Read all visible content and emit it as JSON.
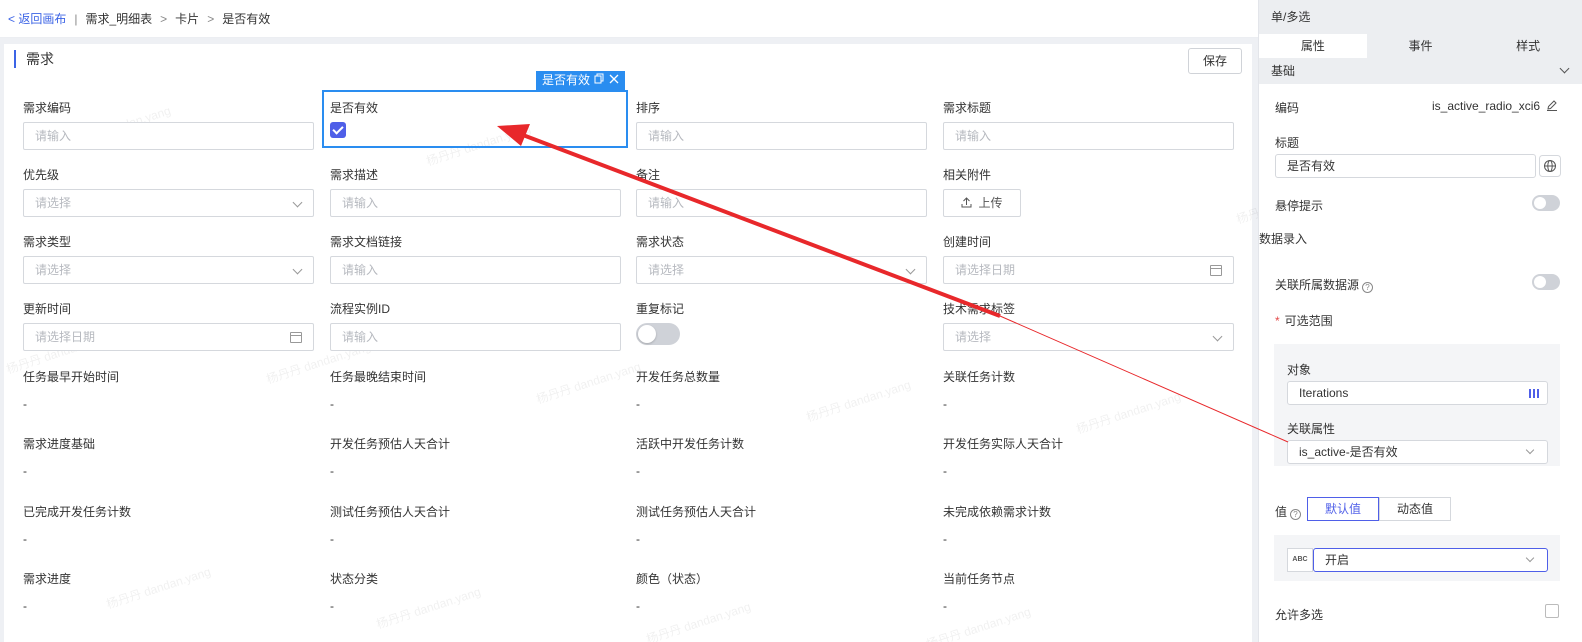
{
  "breadcrumb": {
    "back": "< 返回画布",
    "items": [
      "需求_明细表",
      "卡片",
      "是否有效"
    ],
    "sep1": "|",
    "sep": ">"
  },
  "main": {
    "section_title": "需求",
    "save_label": "保存",
    "selected_tag": "是否有效",
    "fields": {
      "f1": {
        "label": "需求编码",
        "placeholder": "请输入"
      },
      "f2": {
        "label": "是否有效"
      },
      "f3": {
        "label": "排序",
        "placeholder": "请输入"
      },
      "f4": {
        "label": "需求标题",
        "placeholder": "请输入"
      },
      "f5": {
        "label": "优先级",
        "placeholder": "请选择"
      },
      "f6": {
        "label": "需求描述",
        "placeholder": "请输入"
      },
      "f7": {
        "label": "备注",
        "placeholder": "请输入"
      },
      "f8": {
        "label": "相关附件",
        "button": "上传"
      },
      "f9": {
        "label": "需求类型",
        "placeholder": "请选择"
      },
      "f10": {
        "label": "需求文档链接",
        "placeholder": "请输入"
      },
      "f11": {
        "label": "需求状态",
        "placeholder": "请选择"
      },
      "f12": {
        "label": "创建时间",
        "placeholder": "请选择日期"
      },
      "f13": {
        "label": "更新时间",
        "placeholder": "请选择日期"
      },
      "f14": {
        "label": "流程实例ID",
        "placeholder": "请输入"
      },
      "f15": {
        "label": "重复标记"
      },
      "f16": {
        "label": "技术需求标签",
        "placeholder": "请选择"
      },
      "f17": {
        "label": "任务最早开始时间",
        "value": "-"
      },
      "f18": {
        "label": "任务最晚结束时间",
        "value": "-"
      },
      "f19": {
        "label": "开发任务总数量",
        "value": "-"
      },
      "f20": {
        "label": "关联任务计数",
        "value": "-"
      },
      "f21": {
        "label": "需求进度基础",
        "value": "-"
      },
      "f22": {
        "label": "开发任务预估人天合计",
        "value": "-"
      },
      "f23": {
        "label": "活跃中开发任务计数",
        "value": "-"
      },
      "f24": {
        "label": "开发任务实际人天合计",
        "value": "-"
      },
      "f25": {
        "label": "已完成开发任务计数",
        "value": "-"
      },
      "f26": {
        "label": "测试任务预估人天合计",
        "value": "-"
      },
      "f27": {
        "label": "测试任务预估人天合计",
        "value": "-"
      },
      "f28": {
        "label": "未完成依赖需求计数",
        "value": "-"
      },
      "f29": {
        "label": "需求进度",
        "value": "-"
      },
      "f30": {
        "label": "状态分类",
        "value": "-"
      },
      "f31": {
        "label": "颜色（状态）",
        "value": "-"
      },
      "f32": {
        "label": "当前任务节点",
        "value": "-"
      }
    },
    "watermark_text": "杨丹丹 dandan.yang"
  },
  "panel": {
    "title": "单/多选",
    "tabs": [
      "属性",
      "事件",
      "样式"
    ],
    "group_basic": "基础",
    "code_label": "编码",
    "code_value": "is_active_radio_xci6",
    "title_label": "标题",
    "title_value": "是否有效",
    "tooltip_label": "悬停提示",
    "group_data": "数据录入",
    "datasource_label": "关联所属数据源",
    "range_label": "可选范围",
    "required_mark": "*",
    "object_label": "对象",
    "object_value": "Iterations",
    "attr_label": "关联属性",
    "attr_value": "is_active-是否有效",
    "value_label": "值",
    "seg_default": "默认值",
    "seg_dynamic": "动态值",
    "abc_badge": "ABC",
    "default_value": "开启",
    "multi_label": "允许多选",
    "help_glyph": "?"
  },
  "colors": {
    "accent": "#4f5fe8",
    "selection": "#2a8df0",
    "annotation_arrow": "#e8282b"
  },
  "icons": {
    "copy": "copy-icon",
    "close": "close-icon",
    "edit": "edit-icon",
    "globe": "globe-icon",
    "upload": "upload-icon",
    "calendar": "calendar-icon"
  }
}
